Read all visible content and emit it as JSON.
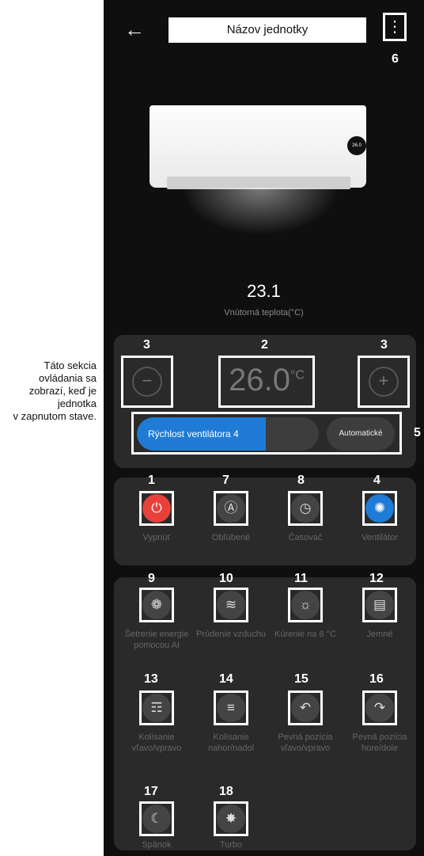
{
  "side_note": {
    "lines": [
      "Táto sekcia",
      "ovládania sa",
      "zobrazí, keď je",
      "jednotka",
      "v zapnutom stave."
    ]
  },
  "header": {
    "title": "Názov jednotky",
    "callout": "6"
  },
  "indoor": {
    "value": "23.1",
    "label": "Vnútorná teplota(°C)"
  },
  "setpoint": {
    "value": "26.0",
    "unit": "°C",
    "callout_minus": "3",
    "callout_value": "2",
    "callout_plus": "3"
  },
  "fan": {
    "label": "Rýchlost ventilátora 4",
    "level_percent": 71,
    "auto_label": "Automatické",
    "callout": "5"
  },
  "ac_display": "26.0",
  "quick": [
    {
      "num": "1",
      "label": "Vypnúť",
      "icon": "power-icon",
      "color": "#e8413a"
    },
    {
      "num": "7",
      "label": "Obľúbené",
      "icon": "auto-icon"
    },
    {
      "num": "8",
      "label": "Časovač",
      "icon": "clock-icon"
    },
    {
      "num": "4",
      "label": "Ventilátor",
      "icon": "fan-icon",
      "color": "#1f7bd6"
    }
  ],
  "modes": [
    {
      "num": "9",
      "label": "Šetrenie energie pomocou AI",
      "icon": "leaf-icon"
    },
    {
      "num": "10",
      "label": "Prúdenie vzduchu",
      "icon": "wind-icon"
    },
    {
      "num": "11",
      "label": "Kúrenie na 8 °C",
      "icon": "sun-icon"
    },
    {
      "num": "12",
      "label": "Jemné",
      "icon": "gentle-icon"
    },
    {
      "num": "13",
      "label": "Kolísanie vľavo/vpravo",
      "icon": "swing-lr-icon"
    },
    {
      "num": "14",
      "label": "Kolísanie nahor/nadol",
      "icon": "swing-ud-icon"
    },
    {
      "num": "15",
      "label": "Pevná pozícia vľavo/vpravo",
      "icon": "fixed-lr-icon"
    },
    {
      "num": "16",
      "label": "Pevná pozícia hore/dole",
      "icon": "fixed-ud-icon"
    },
    {
      "num": "17",
      "label": "Spánok",
      "icon": "moon-icon"
    },
    {
      "num": "18",
      "label": "Turbo",
      "icon": "turbo-icon"
    }
  ]
}
